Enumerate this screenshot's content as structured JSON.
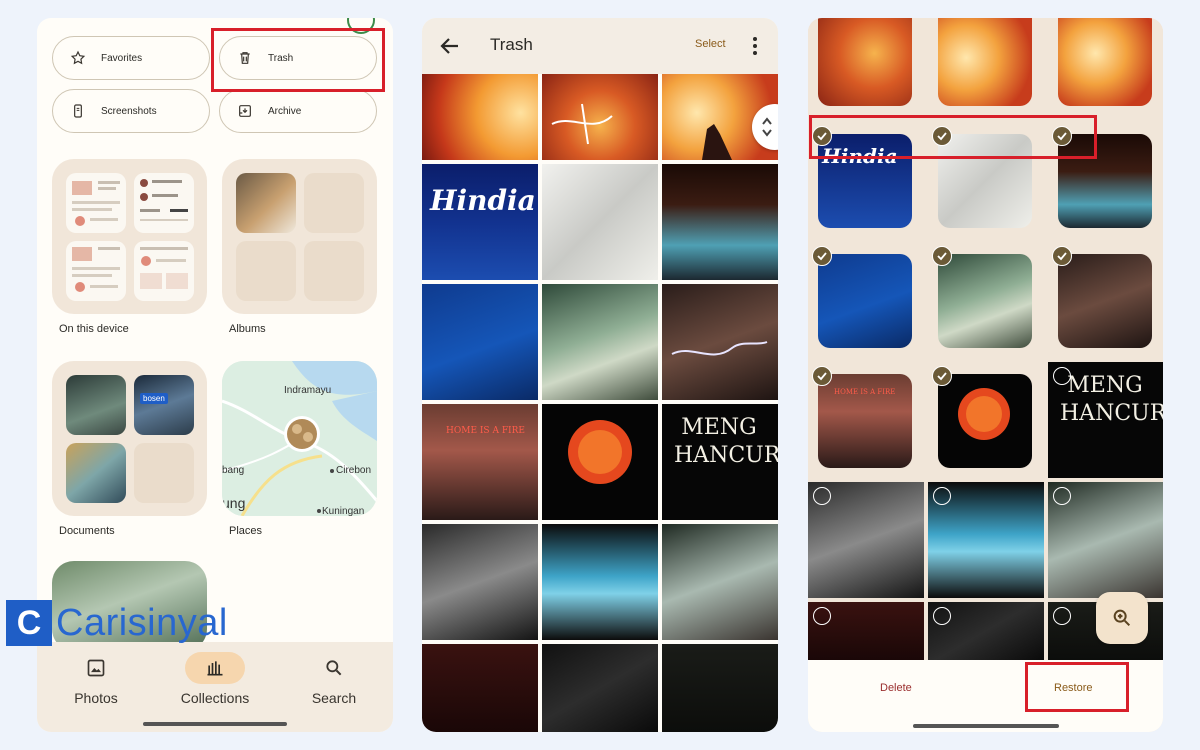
{
  "collections_screen": {
    "pills": [
      {
        "label": "Favorites",
        "icon": "star-icon"
      },
      {
        "label": "Trash",
        "icon": "trash-icon"
      },
      {
        "label": "Screenshots",
        "icon": "phone-icon"
      },
      {
        "label": "Archive",
        "icon": "archive-icon"
      }
    ],
    "cards": {
      "on_this_device": "On this device",
      "albums": "Albums",
      "documents": "Documents",
      "places": "Places"
    },
    "map_labels": {
      "indramayu": "Indramayu",
      "cirebon": "Cirebon",
      "kuningan": "Kuningan",
      "bang": "bang",
      "ung": "ung"
    },
    "nav": [
      {
        "label": "Photos",
        "icon": "photo-icon"
      },
      {
        "label": "Collections",
        "icon": "collections-icon",
        "active": true
      },
      {
        "label": "Search",
        "icon": "search-icon"
      }
    ]
  },
  "watermark": {
    "logo_letter": "C",
    "text": "Carisinyal"
  },
  "trash_screen": {
    "title": "Trash",
    "select_label": "Select",
    "photo_texts": {
      "hindia": "Hindia",
      "home_fire": "HOME IS A FIRE",
      "menghancur": "MENG HANCUR"
    }
  },
  "restore_screen": {
    "delete_label": "Delete",
    "restore_label": "Restore"
  },
  "colors": {
    "highlight": "#d81f2a",
    "accent": "#8a5b1a",
    "card_bg": "#f1e6d9",
    "nav_active": "#f6d6ae"
  }
}
